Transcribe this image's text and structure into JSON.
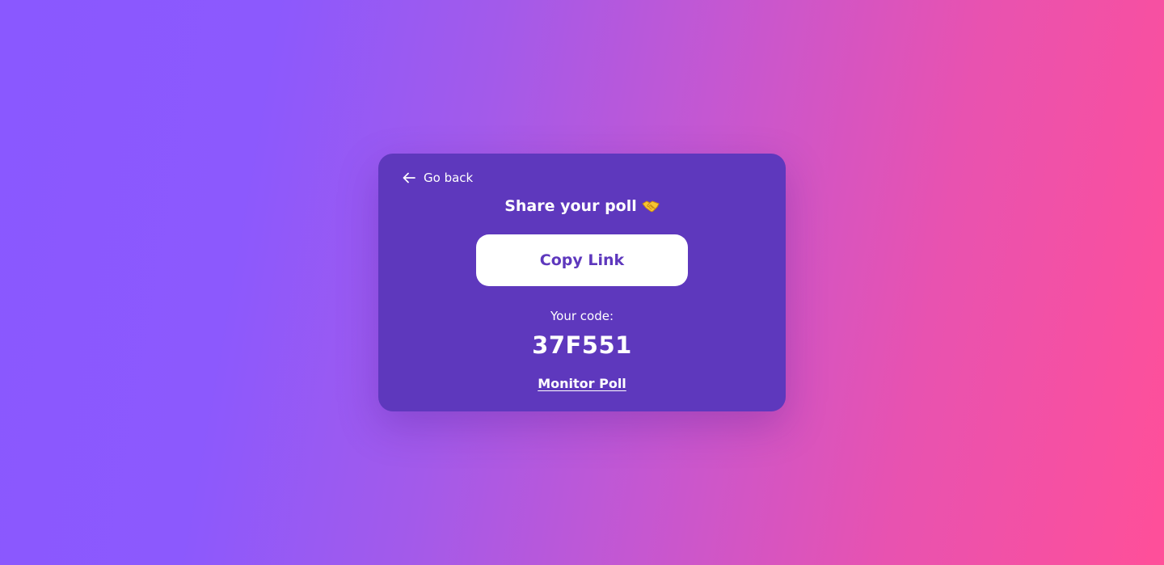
{
  "colors": {
    "card_background": "#5e38bd",
    "button_background": "#ffffff",
    "button_text": "#5e38bd",
    "text": "#ffffff",
    "gradient_start": "#8a58ff",
    "gradient_end": "#ff4f99"
  },
  "share_card": {
    "back": {
      "icon": "arrow-left-icon",
      "label": "Go back"
    },
    "title": "Share your poll",
    "title_icon": "handshake-icon",
    "copy_button_label": "Copy Link",
    "code_label": "Your code:",
    "code_value": "37F551",
    "monitor_link_label": "Monitor Poll"
  }
}
